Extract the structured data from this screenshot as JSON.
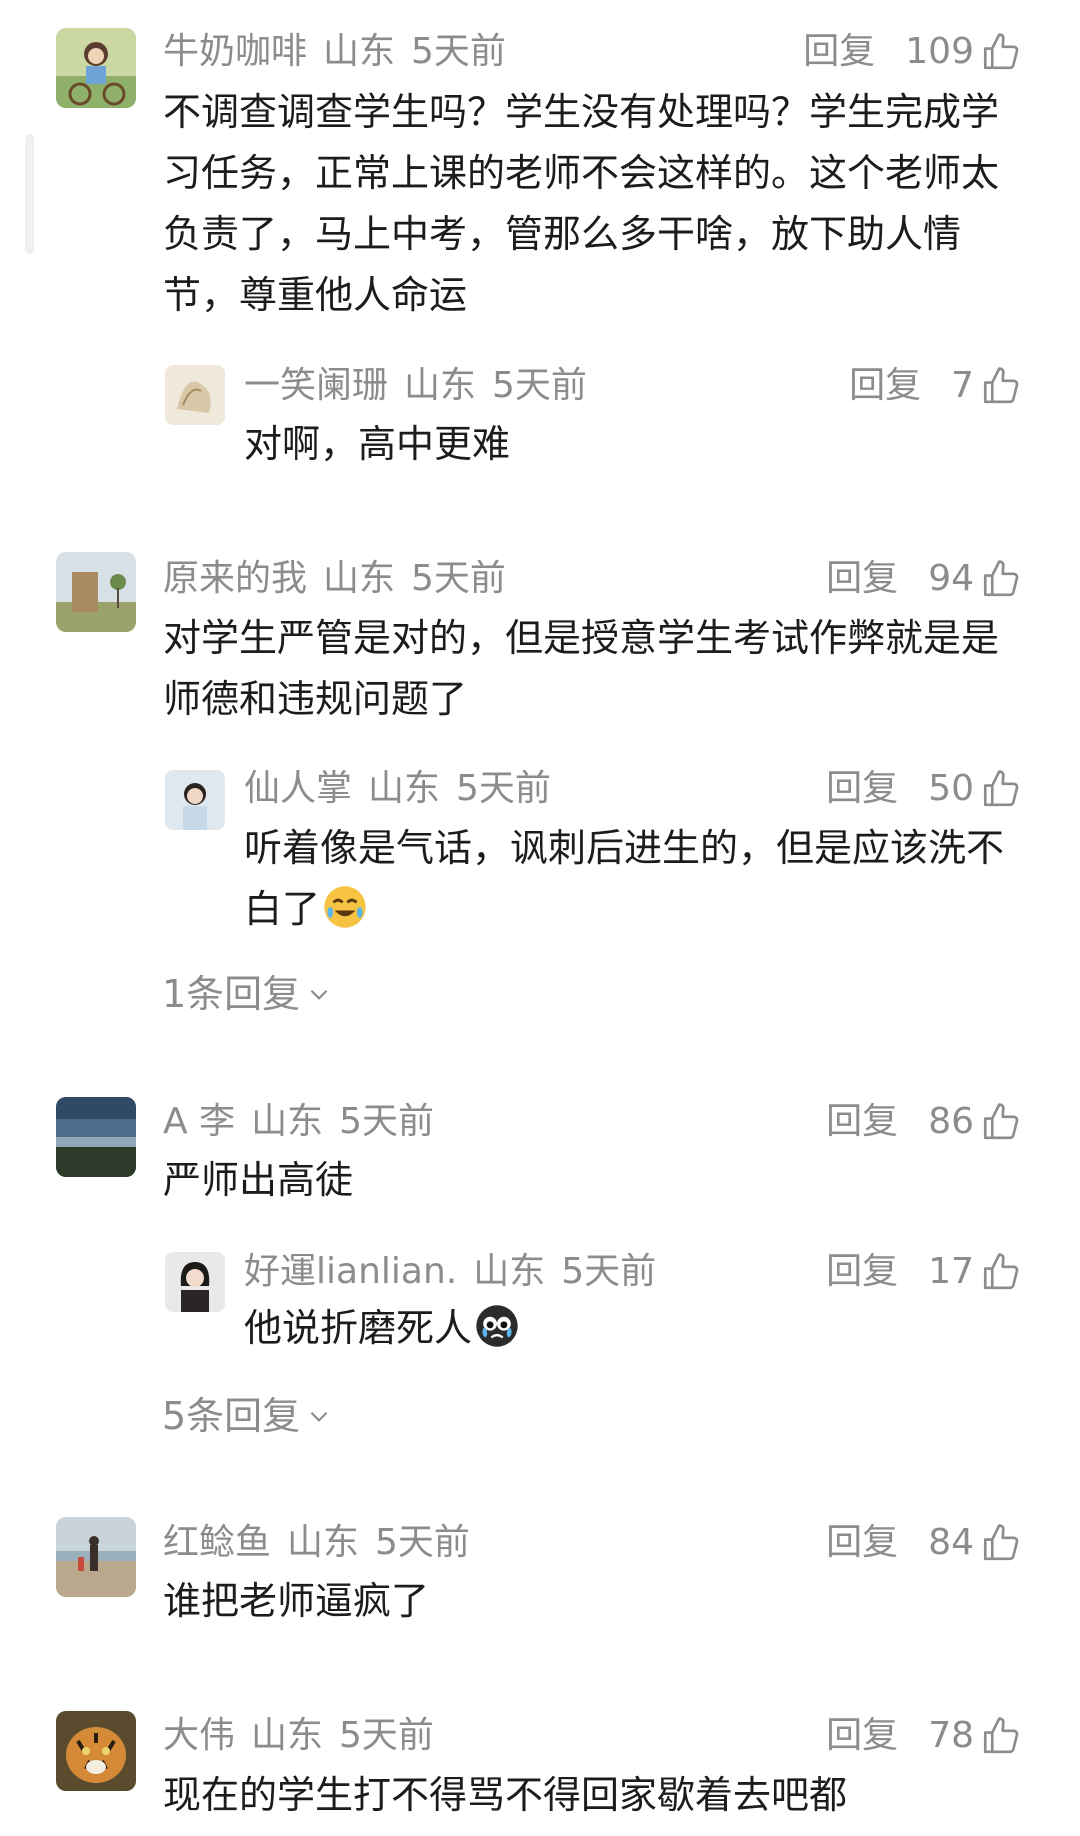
{
  "ui": {
    "reply_label": "回复",
    "like_icon": "thumbs-up-icon"
  },
  "comments": [
    {
      "user": "牛奶咖啡",
      "location": "山东",
      "time": "5天前",
      "likes": "109",
      "avatar": "avatar-girl-cycling",
      "text": "不调查调查学生吗？学生没有处理吗？学生完成学习任务，正常上课的老师不会这样的。这个老师太负责了，马上中考，管那么多干啥，放下助人情节，尊重他人命运",
      "replies": [
        {
          "user": "一笑阑珊",
          "location": "山东",
          "time": "5天前",
          "likes": "7",
          "avatar": "avatar-sketch",
          "text": "对啊，高中更难"
        }
      ]
    },
    {
      "user": "原来的我",
      "location": "山东",
      "time": "5天前",
      "likes": "94",
      "avatar": "avatar-landscape",
      "text": "对学生严管是对的，但是授意学生考试作弊就是是师德和违规问题了",
      "replies": [
        {
          "user": "仙人掌",
          "location": "山东",
          "time": "5天前",
          "likes": "50",
          "avatar": "avatar-woman",
          "text": "听着像是气话，讽刺后进生的，但是应该洗不白了",
          "emoji": "laughing-crying-emoji"
        }
      ],
      "more_replies": "1条回复"
    },
    {
      "user": "A 李",
      "location": "山东",
      "time": "5天前",
      "likes": "86",
      "avatar": "avatar-sky",
      "text": "严师出高徒",
      "replies": [
        {
          "user": "好運lianlian.",
          "location": "山东",
          "time": "5天前",
          "likes": "17",
          "avatar": "avatar-portrait",
          "text": "他说折磨死人",
          "emoji": "crying-face-emoji"
        }
      ],
      "more_replies": "5条回复"
    },
    {
      "user": "红鲶鱼",
      "location": "山东",
      "time": "5天前",
      "likes": "84",
      "avatar": "avatar-beach",
      "text": "谁把老师逼疯了",
      "replies": []
    },
    {
      "user": "大伟",
      "location": "山东",
      "time": "5天前",
      "likes": "78",
      "avatar": "avatar-tiger",
      "text": "现在的学生打不得骂不得回家歇着去吧都",
      "replies": []
    }
  ]
}
